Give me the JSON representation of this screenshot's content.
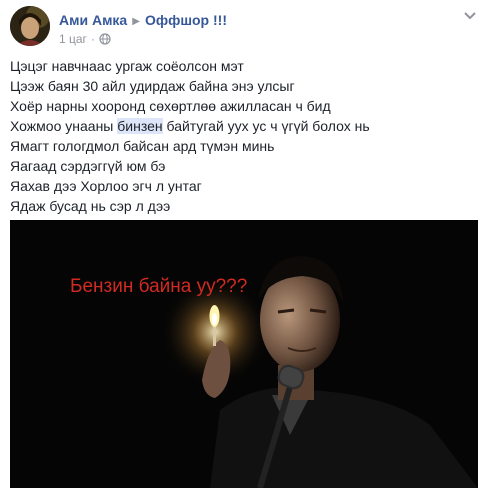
{
  "post": {
    "author": "Ами Амка",
    "group": "Оффшор !!!",
    "time": "1 цаг",
    "dot": "·",
    "lines": [
      "Цэцэг навчнаас ургаж соёолсон мэт",
      "Цээж баян 30 айл удирдаж байна энэ улсыг",
      "Хоёр нарны хооронд сөхөртлөө ажилласан ч бид",
      "Ямагт гологдмол байсан ард түмэн минь",
      "Яагаад сэрдэггүй юм бэ",
      "Яахав дээ Хорлоо эгч л унтаг",
      "Ядаж бусад нь сэр л дээ"
    ],
    "highlight_line": {
      "before": "Хожмоо унааны ",
      "highlight": "бинзен",
      "after": " байтугай уух ус ч үгүй болох нь"
    },
    "image_caption": "Бензин байна уу???"
  },
  "icons": {
    "arrow": "right-triangle-icon",
    "audience": "globe-icon",
    "more": "chevron-down-icon"
  },
  "colors": {
    "link": "#365899",
    "meta": "#90949c",
    "highlight": "#dce6f8",
    "caption": "#d12a22"
  }
}
